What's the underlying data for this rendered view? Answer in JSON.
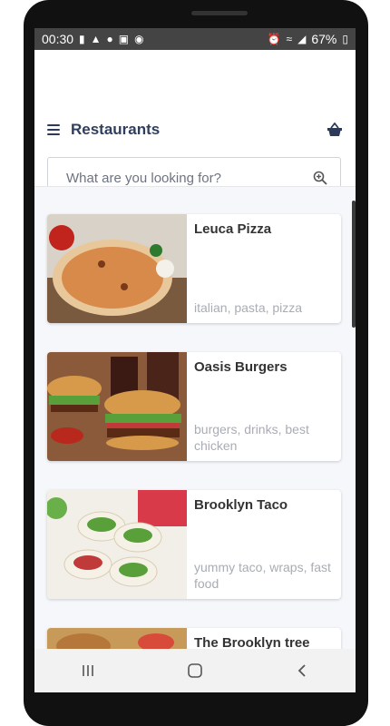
{
  "status_bar": {
    "time": "00:30",
    "battery": "67%"
  },
  "header": {
    "title": "Restaurants"
  },
  "search": {
    "placeholder": "What are you looking for?"
  },
  "restaurants": [
    {
      "name": "Leuca Pizza",
      "tags": "italian, pasta, pizza"
    },
    {
      "name": "Oasis Burgers",
      "tags": "burgers, drinks, best chicken"
    },
    {
      "name": "Brooklyn Taco",
      "tags": "yummy taco, wraps, fast food"
    },
    {
      "name": "The Brooklyn tree",
      "tags": ""
    }
  ],
  "colors": {
    "accent": "#2f3e5e",
    "tag_text": "#a8acb4",
    "list_bg": "#f6f7fb"
  },
  "icons": {
    "menu": "menu-icon",
    "basket": "basket-icon",
    "search": "search-zoom-icon",
    "nav_recent": "recent-apps-icon",
    "nav_home": "home-icon",
    "nav_back": "back-icon"
  }
}
